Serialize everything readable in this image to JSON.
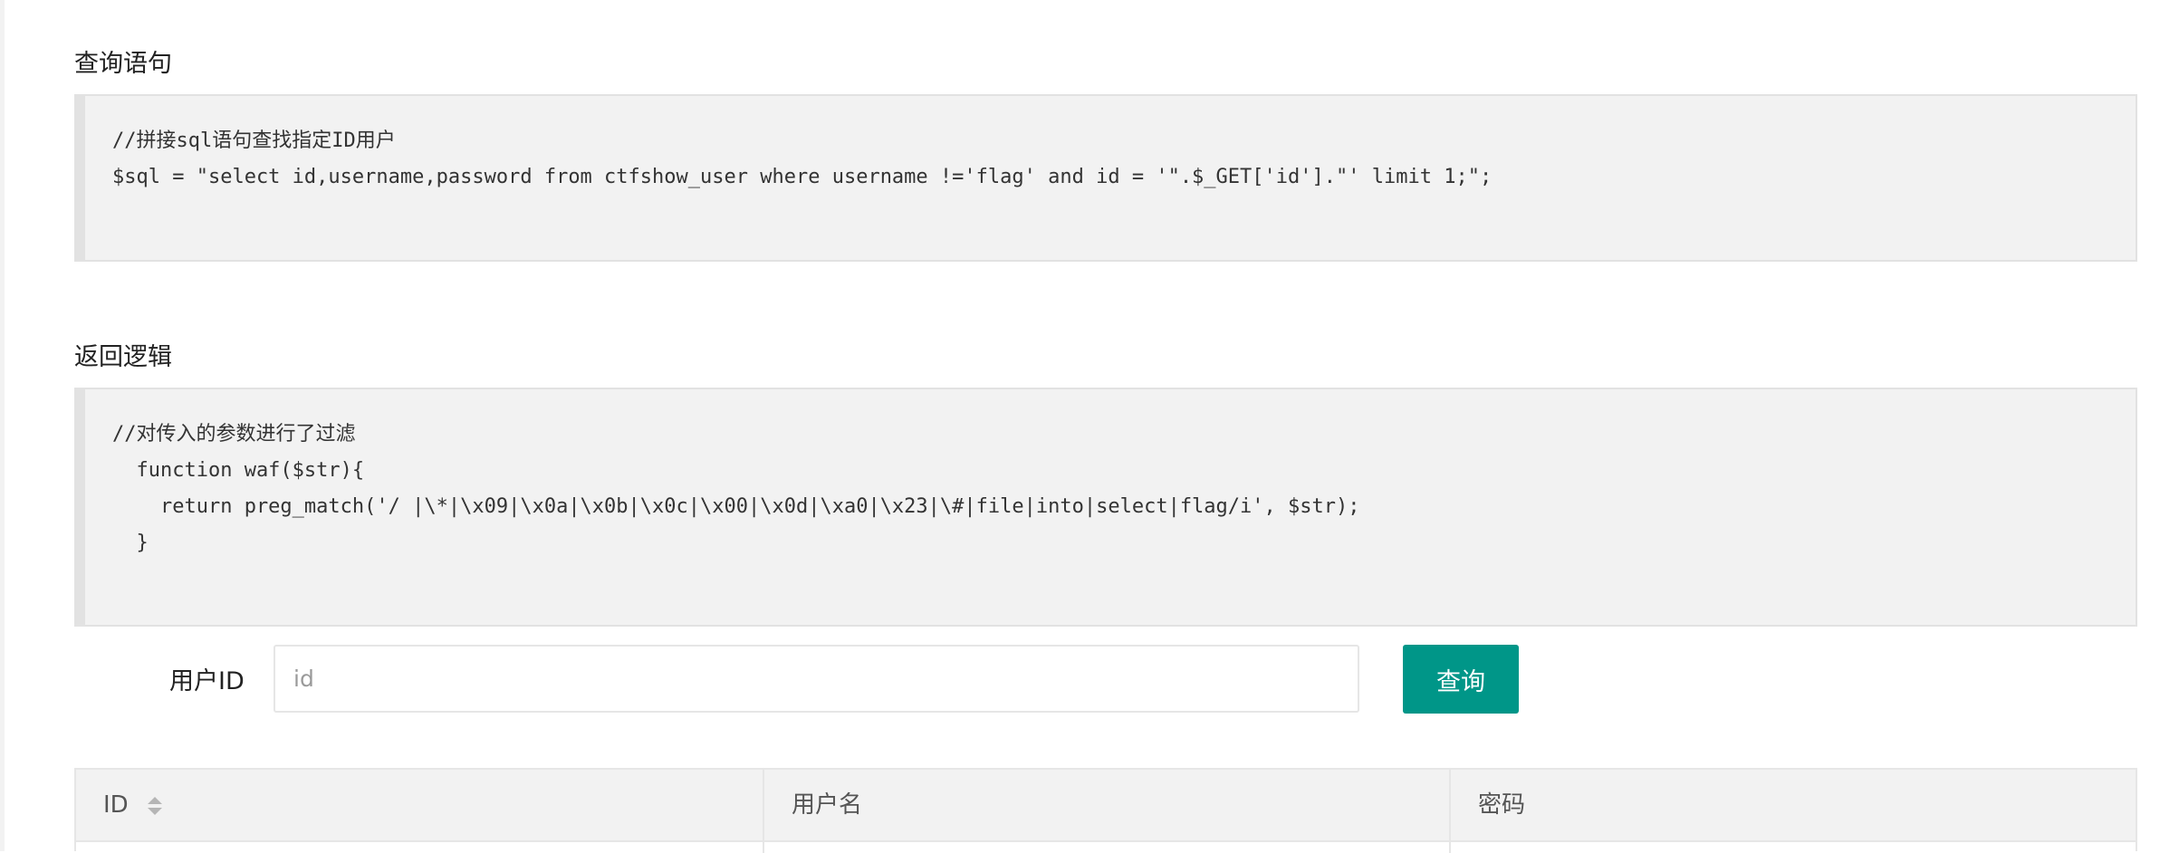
{
  "sections": {
    "query": {
      "title": "查询语句",
      "lines": [
        "//拼接sql语句查找指定ID用户",
        "$sql = \"select id,username,password from ctfshow_user where username !='flag' and id = '\".$_GET['id'].\"' limit 1;\";"
      ]
    },
    "logic": {
      "title": "返回逻辑",
      "lines": [
        "//对传入的参数进行了过滤",
        "  function waf($str){",
        "    return preg_match('/ |\\*|\\x09|\\x0a|\\x0b|\\x0c|\\x00|\\x0d|\\xa0|\\x23|\\#|file|into|select|flag/i', $str);",
        "  }"
      ]
    }
  },
  "form": {
    "label": "用户ID",
    "placeholder": "id",
    "value": "",
    "button_label": "查询"
  },
  "table": {
    "columns": [
      "ID",
      "用户名",
      "密码"
    ],
    "sort_icon": "sort-icon"
  },
  "colors": {
    "accent": "#009688",
    "code_bg": "#f2f2f2"
  }
}
